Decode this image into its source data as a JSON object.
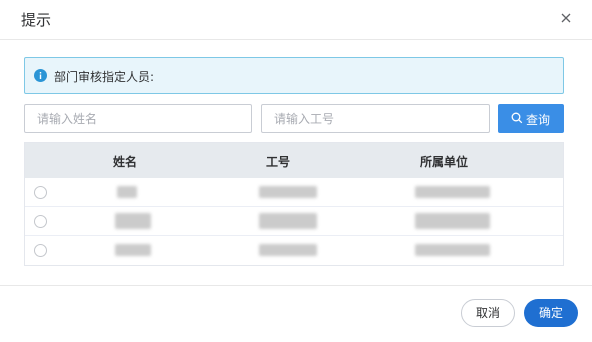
{
  "dialog": {
    "title": "提示",
    "close_icon": "close-icon"
  },
  "notice": {
    "icon": "info-icon",
    "text": "部门审核指定人员:",
    "bg_color": "#e8f5fb",
    "border_color": "#7ec8e6"
  },
  "search": {
    "name_placeholder": "请输入姓名",
    "name_value": "",
    "no_placeholder": "请输入工号",
    "no_value": "",
    "button_icon": "search-icon",
    "button_label": "查询",
    "button_color": "#3a8ee6"
  },
  "table": {
    "columns": [
      "姓名",
      "工号",
      "所属单位"
    ],
    "rows": [
      {
        "selected": false
      },
      {
        "selected": false
      },
      {
        "selected": false
      }
    ]
  },
  "footer": {
    "cancel_label": "取消",
    "ok_label": "确定",
    "ok_color": "#1f6fd1"
  }
}
